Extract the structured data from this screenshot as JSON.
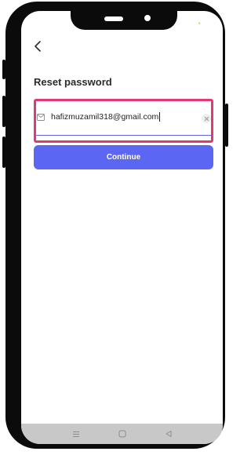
{
  "status_bar": {
    "indicator_glyph": "•",
    "indicator_color": "#c8c820"
  },
  "header": {
    "back_icon": "chevron-left-icon",
    "title": "Reset password"
  },
  "email_form": {
    "field_icon": "mail-icon",
    "email_value": "hafizmuzamil318@gmail.com",
    "clear_icon": "clear-icon",
    "highlight_color": "#e23a6e"
  },
  "actions": {
    "continue_label": "Continue",
    "accent_color": "#5b66f2"
  },
  "nav_bar": {
    "items": [
      "menu-icon",
      "home-icon",
      "back-icon"
    ]
  }
}
